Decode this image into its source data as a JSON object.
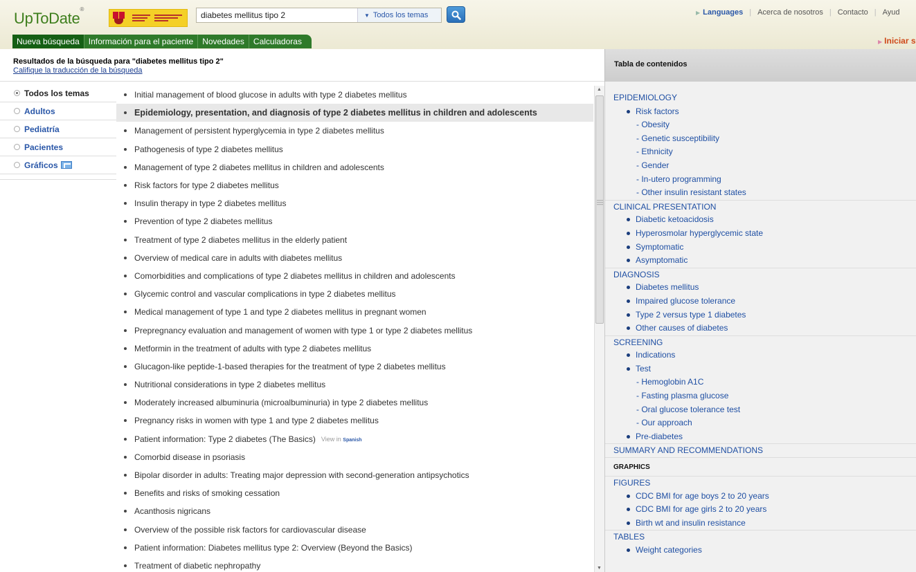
{
  "app": {
    "logo": "UpToDate",
    "logo_mark": "®"
  },
  "search": {
    "query": "diabetes mellitus tipo 2",
    "scope": "Todos los temas"
  },
  "util": {
    "languages": "Languages",
    "about": "Acerca de nosotros",
    "contact": "Contacto",
    "help": "Ayud"
  },
  "nav": {
    "tabs": [
      "Nueva búsqueda",
      "Información para el paciente",
      "Novedades",
      "Calculadoras"
    ],
    "signin": "Iniciar sesió"
  },
  "results": {
    "title": "Resultados de la búsqueda para \"diabetes mellitus tipo 2\"",
    "rate_link": "Califique la traducción de la búsqueda",
    "items": [
      "Initial management of blood glucose in adults with type 2 diabetes mellitus",
      "Epidemiology, presentation, and diagnosis of type 2 diabetes mellitus in children and adolescents",
      "Management of persistent hyperglycemia in type 2 diabetes mellitus",
      "Pathogenesis of type 2 diabetes mellitus",
      "Management of type 2 diabetes mellitus in children and adolescents",
      "Risk factors for type 2 diabetes mellitus",
      "Insulin therapy in type 2 diabetes mellitus",
      "Prevention of type 2 diabetes mellitus",
      "Treatment of type 2 diabetes mellitus in the elderly patient",
      "Overview of medical care in adults with diabetes mellitus",
      "Comorbidities and complications of type 2 diabetes mellitus in children and adolescents",
      "Glycemic control and vascular complications in type 2 diabetes mellitus",
      "Medical management of type 1 and type 2 diabetes mellitus in pregnant women",
      "Prepregnancy evaluation and management of women with type 1 or type 2 diabetes mellitus",
      "Metformin in the treatment of adults with type 2 diabetes mellitus",
      "Glucagon-like peptide-1-based therapies for the treatment of type 2 diabetes mellitus",
      "Nutritional considerations in type 2 diabetes mellitus",
      "Moderately increased albuminuria (microalbuminuria) in type 2 diabetes mellitus",
      "Pregnancy risks in women with type 1 and type 2 diabetes mellitus",
      "Patient information: Type 2 diabetes (The Basics)",
      "Comorbid disease in psoriasis",
      "Bipolar disorder in adults: Treating major depression with second-generation antipsychotics",
      "Benefits and risks of smoking cessation",
      "Acanthosis nigricans",
      "Overview of the possible risk factors for cardiovascular disease",
      "Patient information: Diabetes mellitus type 2: Overview (Beyond the Basics)",
      "Treatment of diabetic nephropathy"
    ],
    "view_in": "View in",
    "view_lang": "Spanish"
  },
  "filters": [
    "Todos los temas",
    "Adultos",
    "Pediatría",
    "Pacientes",
    "Gráficos"
  ],
  "toc": {
    "title": "Tabla de contenidos",
    "sections": [
      {
        "title": "EPIDEMIOLOGY"
      },
      {
        "title": "CLINICAL PRESENTATION"
      },
      {
        "title": "DIAGNOSIS"
      },
      {
        "title": "SCREENING"
      },
      {
        "title": "SUMMARY AND RECOMMENDATIONS"
      },
      {
        "title": "GRAPHICS"
      },
      {
        "title": "FIGURES"
      },
      {
        "title": "TABLES"
      }
    ],
    "epi": {
      "risk": "Risk factors",
      "subs": [
        "Obesity",
        "Genetic susceptibility",
        "Ethnicity",
        "Gender",
        "In-utero programming",
        "Other insulin resistant states"
      ]
    },
    "clin": [
      "Diabetic ketoacidosis",
      "Hyperosmolar hyperglycemic state",
      "Symptomatic",
      "Asymptomatic"
    ],
    "diag": [
      "Diabetes mellitus",
      "Impaired glucose tolerance",
      "Type 2 versus type 1 diabetes",
      "Other causes of diabetes"
    ],
    "screen": {
      "indications": "Indications",
      "test": "Test",
      "subs": [
        "Hemoglobin A1C",
        "Fasting plasma glucose",
        "Oral glucose tolerance test",
        "Our approach"
      ],
      "pre": "Pre-diabetes"
    },
    "figures": [
      "CDC BMI for age boys 2 to 20 years",
      "CDC BMI for age girls 2 to 20 years",
      "Birth wt and insulin resistance"
    ],
    "tables": [
      "Weight categories"
    ]
  },
  "colors": {
    "brand_green": "#3d7e1c",
    "nav_green": "#2f7a2a",
    "link_blue": "#1f4fa3",
    "signin_orange": "#cf4a1a"
  }
}
